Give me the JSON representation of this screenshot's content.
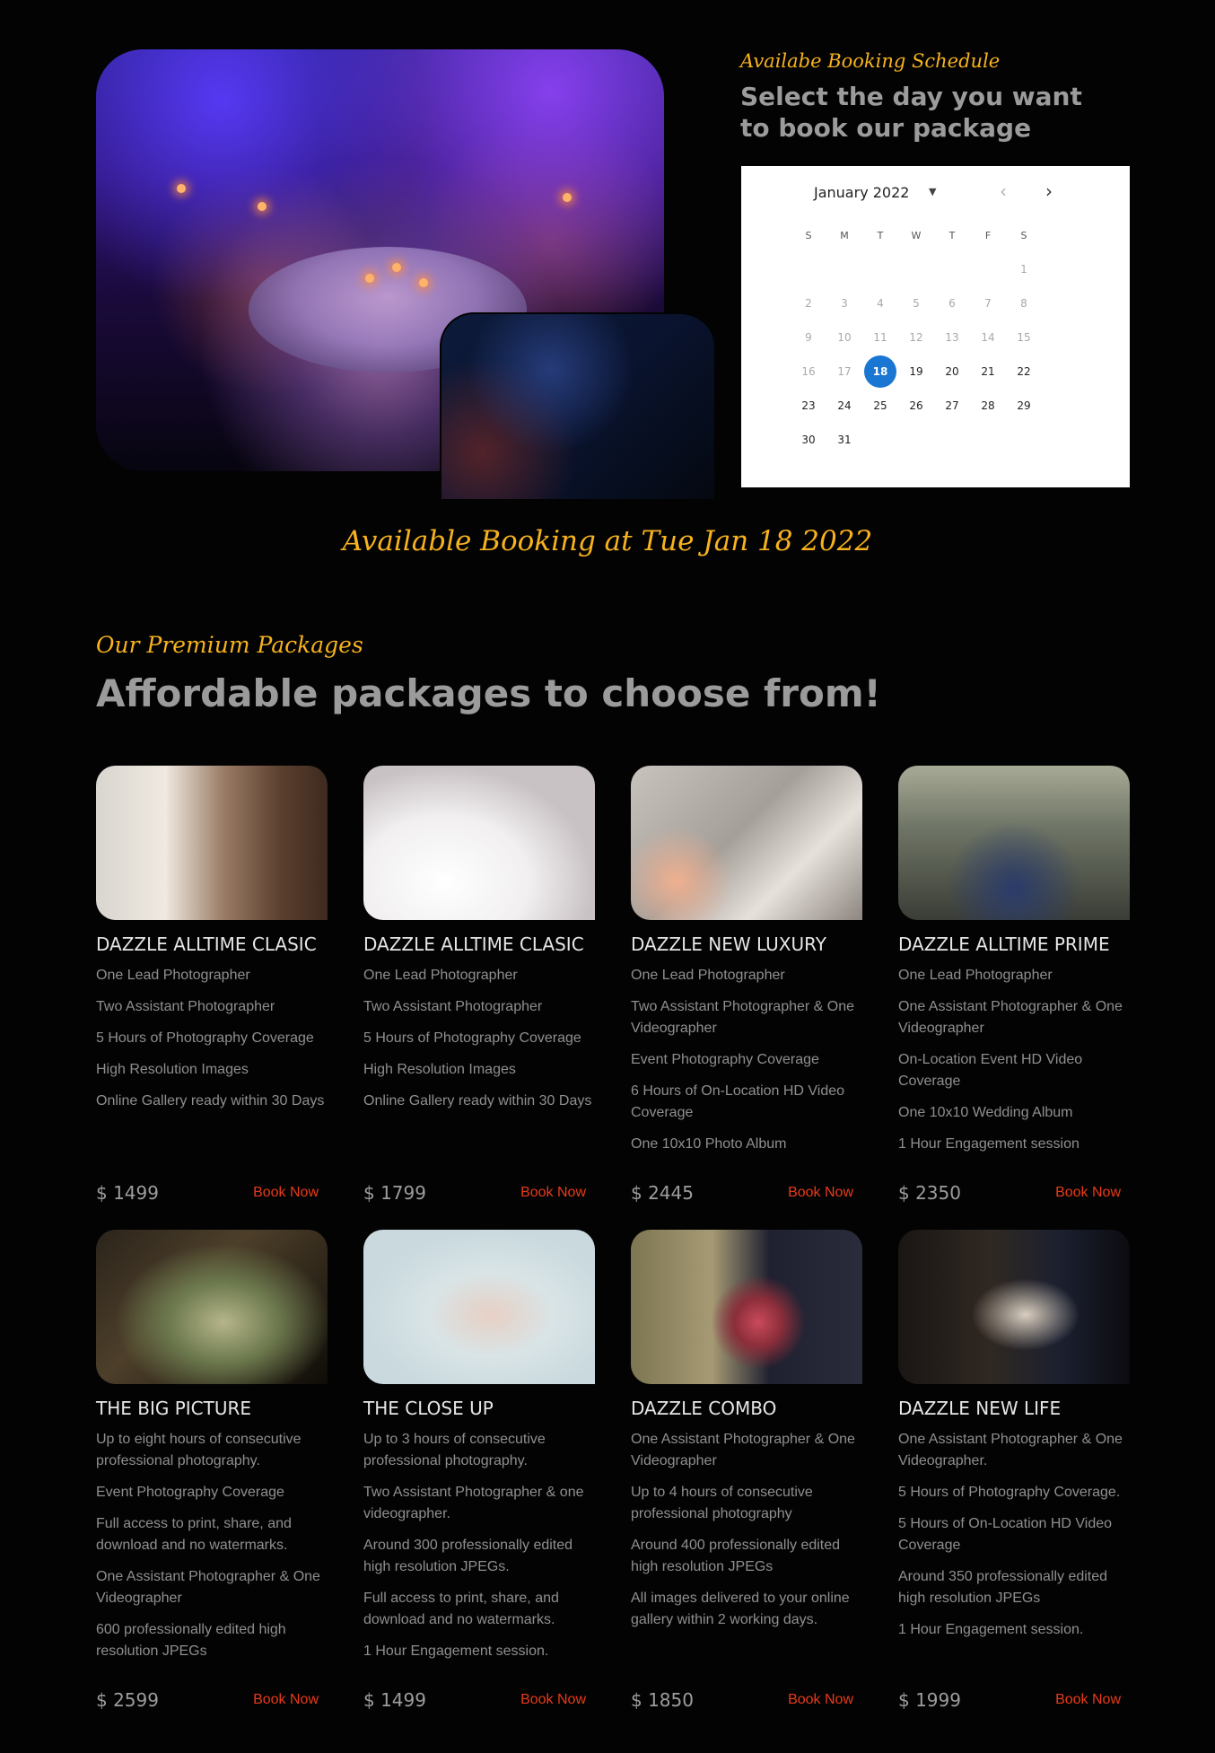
{
  "booking": {
    "kicker": "Availabe Booking Schedule",
    "title": "Select the day you want to book our package",
    "calendar": {
      "month_label": "January 2022",
      "dropdown_icon": "caret-down-icon",
      "prev_icon": "chevron-left-icon",
      "next_icon": "chevron-right-icon",
      "weekdays": [
        "S",
        "M",
        "T",
        "W",
        "T",
        "F",
        "S"
      ],
      "selected_day": "18",
      "weeks": [
        [
          "",
          "",
          "",
          "",
          "",
          "",
          "1"
        ],
        [
          "2",
          "3",
          "4",
          "5",
          "6",
          "7",
          "8"
        ],
        [
          "9",
          "10",
          "11",
          "12",
          "13",
          "14",
          "15"
        ],
        [
          "16",
          "17",
          "18",
          "19",
          "20",
          "21",
          "22"
        ],
        [
          "23",
          "24",
          "25",
          "26",
          "27",
          "28",
          "29"
        ],
        [
          "30",
          "31",
          "",
          "",
          "",
          "",
          ""
        ]
      ]
    },
    "available_text": "Available Booking at Tue Jan 18 2022"
  },
  "packages": {
    "kicker": "Our Premium Packages",
    "title": "Affordable packages to choose from!",
    "book_label": "Book Now",
    "items": [
      {
        "name": "DAZZLE ALLTIME CLASIC",
        "features": [
          "One Lead Photographer",
          "Two Assistant Photographer",
          "5 Hours of Photography Coverage",
          "High Resolution Images",
          "Online Gallery ready within 30 Days"
        ],
        "price": "$ 1499"
      },
      {
        "name": "DAZZLE ALLTIME CLASIC",
        "features": [
          "One Lead Photographer",
          "Two Assistant Photographer",
          "5 Hours of Photography Coverage",
          "High Resolution Images",
          "Online Gallery ready within 30 Days"
        ],
        "price": "$ 1799"
      },
      {
        "name": "DAZZLE NEW LUXURY",
        "features": [
          "One Lead Photographer",
          "Two Assistant Photographer & One Videographer",
          "Event Photography Coverage",
          "6 Hours of On-Location HD Video Coverage",
          "One 10x10 Photo Album"
        ],
        "price": "$ 2445"
      },
      {
        "name": "DAZZLE ALLTIME PRIME",
        "features": [
          "One Lead Photographer",
          "One Assistant Photographer & One Videographer",
          "On-Location Event HD Video Coverage",
          "One 10x10 Wedding Album",
          "1 Hour Engagement session"
        ],
        "price": "$ 2350"
      },
      {
        "name": "THE BIG PICTURE",
        "features": [
          "Up to eight hours of consecutive professional photography.",
          "Event Photography Coverage",
          "Full access to print, share, and download and no watermarks.",
          "One Assistant Photographer & One Videographer",
          "600 professionally edited high resolution JPEGs"
        ],
        "price": "$ 2599"
      },
      {
        "name": "THE CLOSE UP",
        "features": [
          "Up to 3 hours of consecutive professional photography.",
          "Two Assistant Photographer & one videographer.",
          "Around 300 professionally edited high resolution JPEGs.",
          "Full access to print, share, and download and no watermarks.",
          "1 Hour Engagement session."
        ],
        "price": "$ 1499"
      },
      {
        "name": "DAZZLE COMBO",
        "features": [
          "One Assistant Photographer & One Videographer",
          "Up to 4 hours of consecutive professional photography",
          "Around 400 professionally edited high resolution JPEGs",
          "All images delivered to your online gallery within 2 working days."
        ],
        "price": "$ 1850"
      },
      {
        "name": "DAZZLE NEW LIFE",
        "features": [
          "One Assistant Photographer & One Videographer.",
          "5 Hours of Photography Coverage.",
          "5 Hours of On-Location HD Video Coverage",
          "Around 350 professionally edited high resolution JPEGs",
          "1 Hour Engagement session."
        ],
        "price": "$ 1999"
      }
    ]
  }
}
